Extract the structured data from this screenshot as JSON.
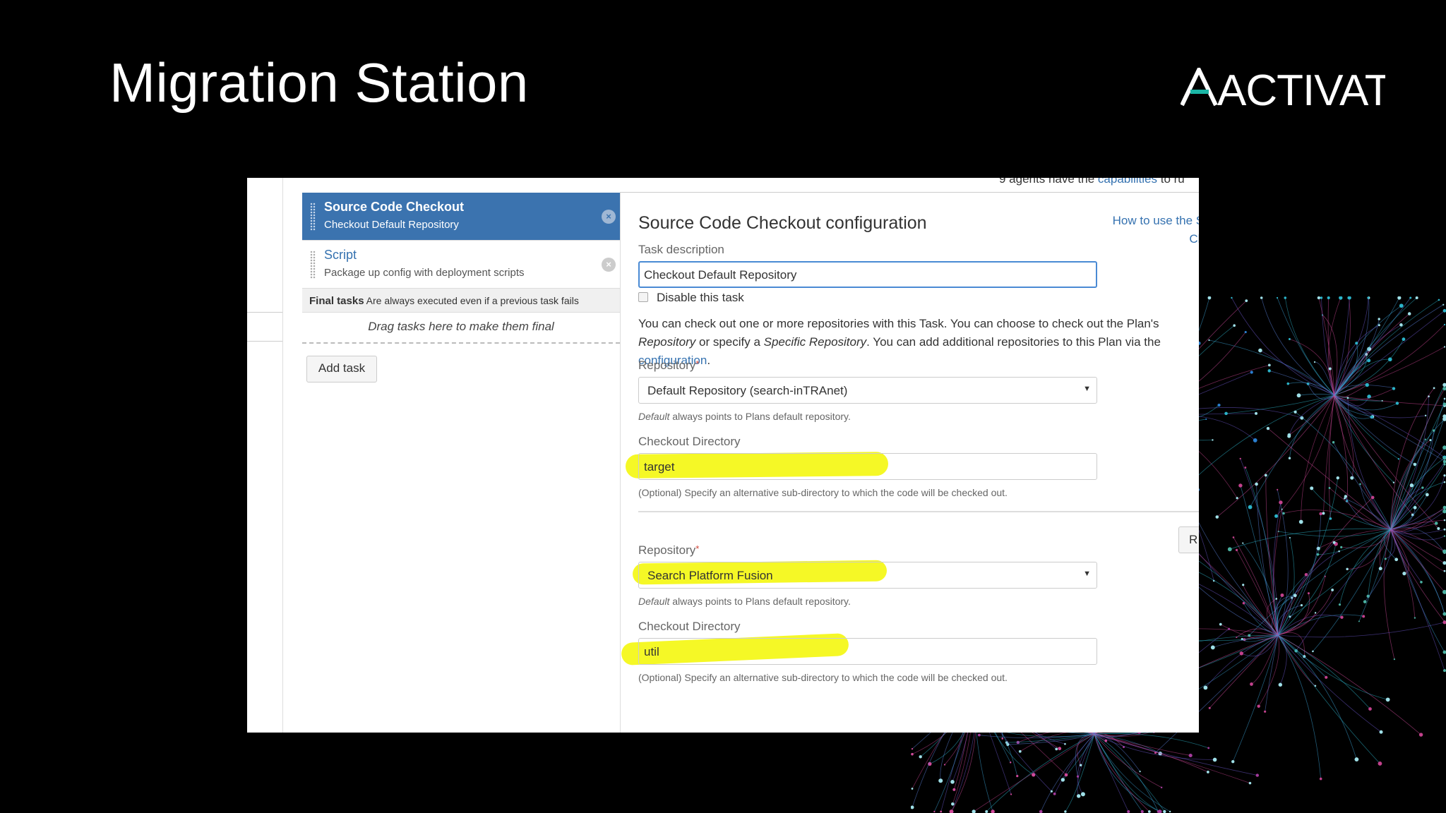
{
  "slide": {
    "title": "Migration Station",
    "logo_text": "ACTIVATE",
    "logo_accent_color": "#1bb6a6"
  },
  "screenshot": {
    "top_note": {
      "prefix": "9 agents have the",
      "link": "capabilities",
      "suffix": "to ru"
    },
    "tasks": [
      {
        "title": "Source Code Checkout",
        "subtitle": "Checkout Default Repository",
        "selected": true
      },
      {
        "title": "Script",
        "subtitle": "Package up config with deployment scripts",
        "selected": false
      }
    ],
    "final_tasks": {
      "label": "Final tasks",
      "description": "Are always executed even if a previous task fails"
    },
    "drag_hint": "Drag tasks here to make them final",
    "add_task_label": "Add task",
    "config": {
      "title": "Source Code Checkout configuration",
      "help_link": "How to use the Sou\nChec",
      "task_description_label": "Task description",
      "task_description_value": "Checkout Default Repository",
      "disable_label": "Disable this task",
      "paragraph": {
        "line1": "You can check out one or more repositories with this Task. You can choose to check out the Plan's",
        "line2_italic1": "Repository",
        "line2_mid": " or specify a ",
        "line2_italic2": "Specific Repository",
        "line2_end": ". You can add additional repositories to this Plan via the",
        "line3_link": "configuration",
        "line3_end": "."
      },
      "repositories": [
        {
          "repository_label": "Repository",
          "repository_value": "Default Repository (search-inTRAnet)",
          "repository_hint_italic": "Default",
          "repository_hint": " always points to Plans default repository.",
          "checkout_dir_label": "Checkout Directory",
          "checkout_dir_value": "target",
          "checkout_dir_hint": "(Optional) Specify an alternative sub-directory to which the code will be checked out."
        },
        {
          "repository_label": "Repository",
          "repository_value": "Search Platform Fusion",
          "repository_hint_italic": "Default",
          "repository_hint": " always points to Plans default repository.",
          "checkout_dir_label": "Checkout Directory",
          "checkout_dir_value": "util",
          "checkout_dir_hint": "(Optional) Specify an alternative sub-directory to which the code will be checked out."
        }
      ],
      "side_button_label": "R"
    },
    "colors": {
      "selected_task_bg": "#3b73af",
      "link": "#3572b0",
      "highlighter": "#f4f700"
    }
  }
}
